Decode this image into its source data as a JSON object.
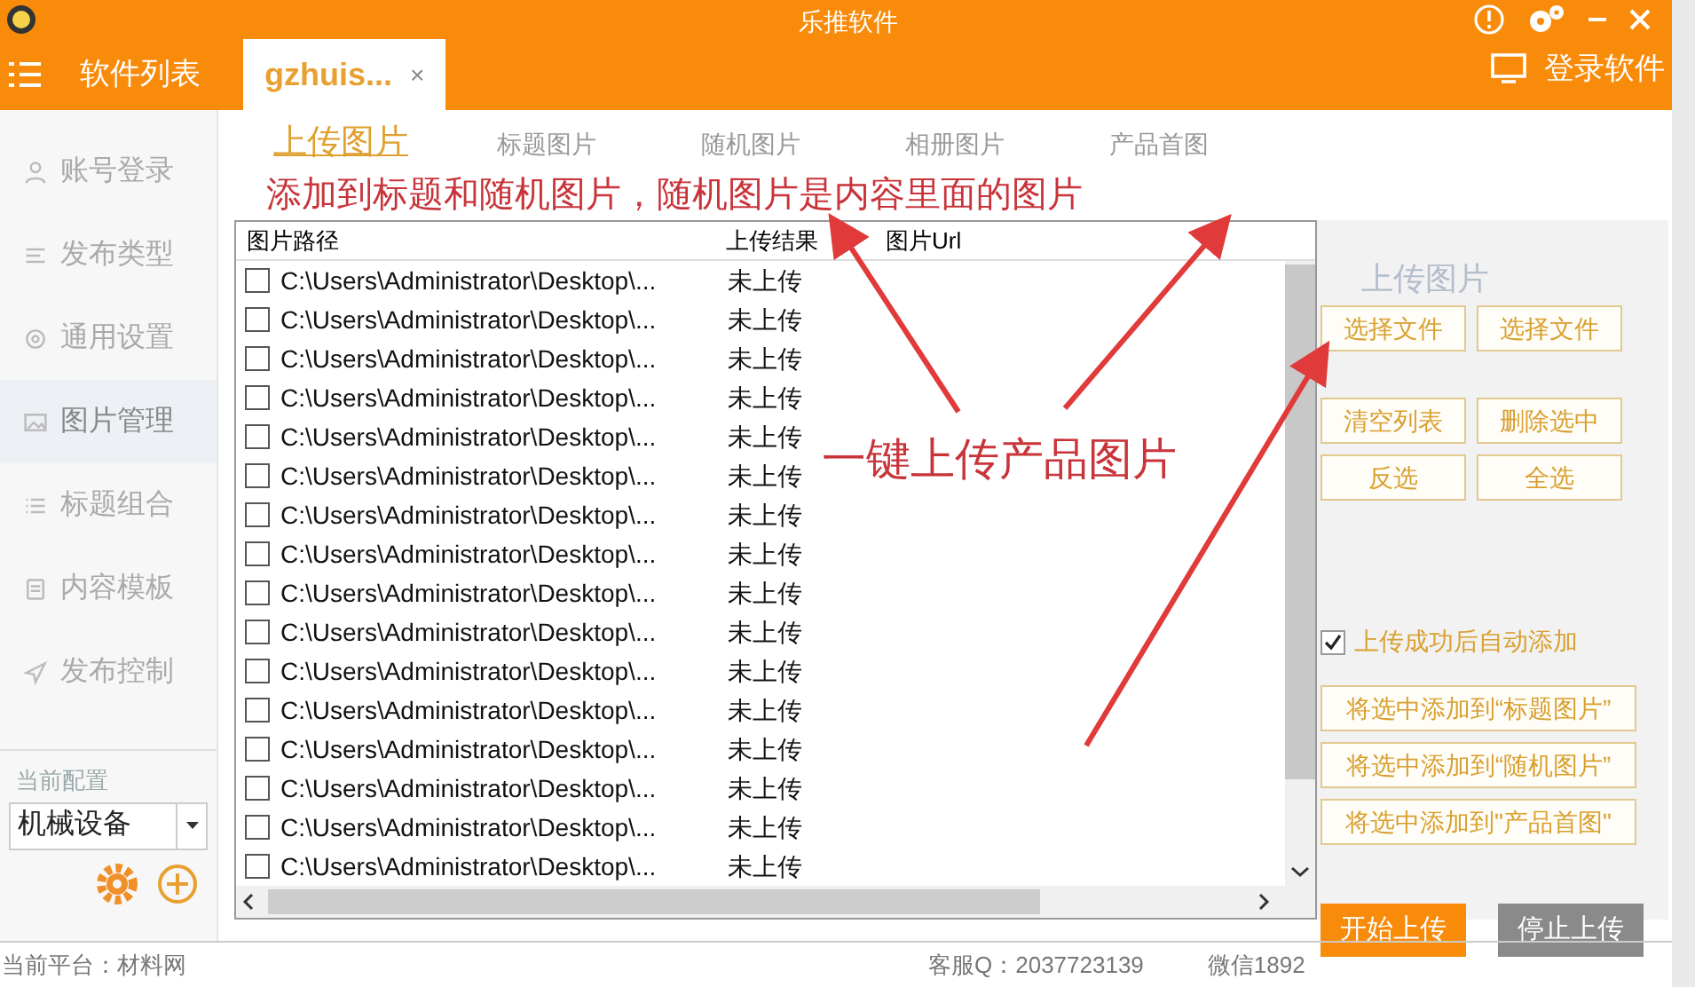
{
  "window": {
    "title": "乐推软件",
    "nav_tabs": [
      {
        "label": "软件列表",
        "selected": false
      },
      {
        "label": "gzhuis...",
        "selected": true,
        "close": "×"
      }
    ],
    "login": "登录软件"
  },
  "sidebar": {
    "items": [
      {
        "label": "账号登录",
        "selected": false
      },
      {
        "label": "发布类型",
        "selected": false
      },
      {
        "label": "通用设置",
        "selected": false
      },
      {
        "label": "图片管理",
        "selected": true
      },
      {
        "label": "标题组合",
        "selected": false
      },
      {
        "label": "内容模板",
        "selected": false
      },
      {
        "label": "发布控制",
        "selected": false
      }
    ],
    "config_label": "当前配置",
    "config_value": "机械设备"
  },
  "tabs": [
    {
      "label": "上传图片",
      "selected": true
    },
    {
      "label": "标题图片",
      "selected": false
    },
    {
      "label": "随机图片",
      "selected": false
    },
    {
      "label": "相册图片",
      "selected": false
    },
    {
      "label": "产品首图",
      "selected": false
    }
  ],
  "table": {
    "columns": [
      "图片路径",
      "上传结果",
      "图片Url"
    ],
    "rows": [
      {
        "path": "C:\\Users\\Administrator\\Desktop\\...",
        "result": "未上传",
        "checked": false
      },
      {
        "path": "C:\\Users\\Administrator\\Desktop\\...",
        "result": "未上传",
        "checked": false
      },
      {
        "path": "C:\\Users\\Administrator\\Desktop\\...",
        "result": "未上传",
        "checked": false
      },
      {
        "path": "C:\\Users\\Administrator\\Desktop\\...",
        "result": "未上传",
        "checked": false
      },
      {
        "path": "C:\\Users\\Administrator\\Desktop\\...",
        "result": "未上传",
        "checked": false
      },
      {
        "path": "C:\\Users\\Administrator\\Desktop\\...",
        "result": "未上传",
        "checked": false
      },
      {
        "path": "C:\\Users\\Administrator\\Desktop\\...",
        "result": "未上传",
        "checked": false
      },
      {
        "path": "C:\\Users\\Administrator\\Desktop\\...",
        "result": "未上传",
        "checked": false
      },
      {
        "path": "C:\\Users\\Administrator\\Desktop\\...",
        "result": "未上传",
        "checked": false
      },
      {
        "path": "C:\\Users\\Administrator\\Desktop\\...",
        "result": "未上传",
        "checked": false
      },
      {
        "path": "C:\\Users\\Administrator\\Desktop\\...",
        "result": "未上传",
        "checked": false
      },
      {
        "path": "C:\\Users\\Administrator\\Desktop\\...",
        "result": "未上传",
        "checked": false
      },
      {
        "path": "C:\\Users\\Administrator\\Desktop\\...",
        "result": "未上传",
        "checked": false
      },
      {
        "path": "C:\\Users\\Administrator\\Desktop\\...",
        "result": "未上传",
        "checked": false
      },
      {
        "path": "C:\\Users\\Administrator\\Desktop\\...",
        "result": "未上传",
        "checked": false
      },
      {
        "path": "C:\\Users\\Administrator\\Desktop\\...",
        "result": "未上传",
        "checked": false
      }
    ]
  },
  "panel": {
    "title": "上传图片",
    "button_rows": [
      [
        "选择文件",
        "选择文件"
      ],
      [
        "清空列表",
        "删除选中"
      ],
      [
        "反选",
        "全选"
      ]
    ],
    "auto_add": {
      "label": "上传成功后自动添加",
      "checked": true
    },
    "add_buttons": [
      "将选中添加到“标题图片”",
      "将选中添加到“随机图片”",
      "将选中添加到\"产品首图\""
    ],
    "start": "开始上传",
    "stop": "停止上传"
  },
  "annotations": [
    "添加到标题和随机图片，随机图片是内容里面的图片",
    "一键上传产品图片"
  ],
  "status_bar": {
    "platform": "当前平台：材料网",
    "service": "客服Q：2037723139",
    "wechat": "微信1892"
  }
}
